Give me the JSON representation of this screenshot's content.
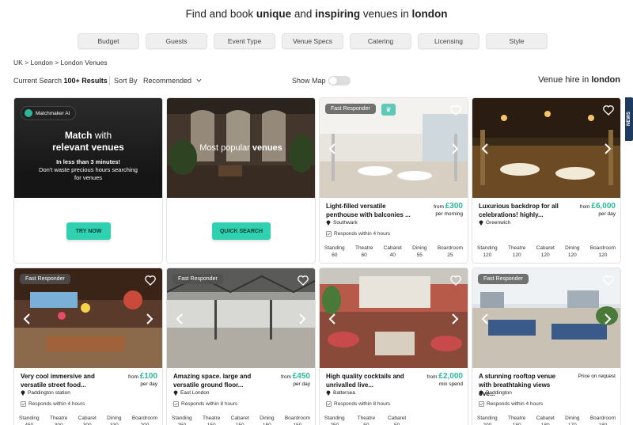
{
  "headline": {
    "prefix": "Find and book ",
    "w1": "unique",
    "mid1": " and ",
    "w2": "inspiring",
    "mid2": " venues in ",
    "city": "london"
  },
  "filters": [
    "Budget",
    "Guests",
    "Event Type",
    "Venue Specs",
    "Catering",
    "Licensing",
    "Style"
  ],
  "breadcrumb": "UK > London > London Venues",
  "toolbar": {
    "current_label": "Current Search ",
    "current_count": "100+ Results",
    "sort_label": "Sort By",
    "sort_value": "Recommended",
    "show_map": "Show Map",
    "hire_prefix": "Venue hire in ",
    "hire_city": "london"
  },
  "news_tab": "NEWS",
  "promo_match": {
    "chip": "Matchmaker AI",
    "title1": "Match",
    "title1b": " with",
    "title2": "relevant venues",
    "sub1": "In less than 3 minutes!",
    "sub2": "Don't waste precious hours searching",
    "sub3": "for venues",
    "cta": "TRY NOW"
  },
  "promo_popular": {
    "title_a": "Most popular ",
    "title_b": "venues",
    "cta": "QUICK SEARCH"
  },
  "venues": [
    {
      "badge": "Fast Responder",
      "title": "Light-filled versatile penthouse with balconies ...",
      "price_prefix": "from ",
      "price": "£300",
      "price_sub": "per morning",
      "location": "Southwark",
      "respond": "Responds within 4 hours",
      "caps": [
        {
          "k": "Standing",
          "v": "60"
        },
        {
          "k": "Theatre",
          "v": "60"
        },
        {
          "k": "Cabaret",
          "v": "40"
        },
        {
          "k": "Dining",
          "v": "55"
        },
        {
          "k": "Boardroom",
          "v": "25"
        }
      ]
    },
    {
      "badge": "",
      "title": "Luxurious backdrop for all celebrations! highly...",
      "price_prefix": "from ",
      "price": "£6,000",
      "price_sub": "per day",
      "location": "Greenwich",
      "respond": "",
      "caps": [
        {
          "k": "Standing",
          "v": "120"
        },
        {
          "k": "Theatre",
          "v": "120"
        },
        {
          "k": "Cabaret",
          "v": "120"
        },
        {
          "k": "Dining",
          "v": "120"
        },
        {
          "k": "Boardroom",
          "v": "120"
        }
      ]
    },
    {
      "badge": "Fast Responder",
      "title": "Very cool immersive and versatile street food...",
      "price_prefix": "from ",
      "price": "£100",
      "price_sub": "per day",
      "location": "Paddington station",
      "respond": "Responds within 4 hours",
      "caps": [
        {
          "k": "Standing",
          "v": "450"
        },
        {
          "k": "Theatre",
          "v": "300"
        },
        {
          "k": "Cabaret",
          "v": "300"
        },
        {
          "k": "Dining",
          "v": "330"
        },
        {
          "k": "Boardroom",
          "v": "200"
        }
      ]
    },
    {
      "badge": "Fast Responder",
      "title": "Amazing space. large and versatile ground floor...",
      "price_prefix": "from ",
      "price": "£450",
      "price_sub": "per day",
      "location": "East London",
      "respond": "Responds within 8 hours",
      "caps": [
        {
          "k": "Standing",
          "v": "250"
        },
        {
          "k": "Theatre",
          "v": "150"
        },
        {
          "k": "Cabaret",
          "v": "150"
        },
        {
          "k": "Dining",
          "v": "150"
        },
        {
          "k": "Boardroom",
          "v": "150"
        }
      ]
    },
    {
      "badge": "",
      "title": "High quality cocktails and unrivalled live...",
      "price_prefix": "from ",
      "price": "£2,000",
      "price_sub": "min spend",
      "location": "Battersea",
      "respond": "Responds within 8 hours",
      "caps": [
        {
          "k": "Standing",
          "v": "250"
        },
        {
          "k": "Theatre",
          "v": "50"
        },
        {
          "k": "Cabaret",
          "v": "50"
        }
      ]
    },
    {
      "badge": "Fast Responder",
      "title": "A stunning rooftop venue with breathtaking views ove...",
      "price_prefix": "",
      "price": "",
      "price_sub": "Price on request",
      "location": "Paddington",
      "respond": "Responds within 4 hours",
      "caps": [
        {
          "k": "Standing",
          "v": "200"
        },
        {
          "k": "Theatre",
          "v": "180"
        },
        {
          "k": "Cabaret",
          "v": "180"
        },
        {
          "k": "Dining",
          "v": "170"
        },
        {
          "k": "Boardroom",
          "v": "180"
        }
      ]
    }
  ],
  "colors": {
    "accent": "#2bb89a",
    "cta": "#2fd1b1",
    "badge_bg": "#505050"
  }
}
